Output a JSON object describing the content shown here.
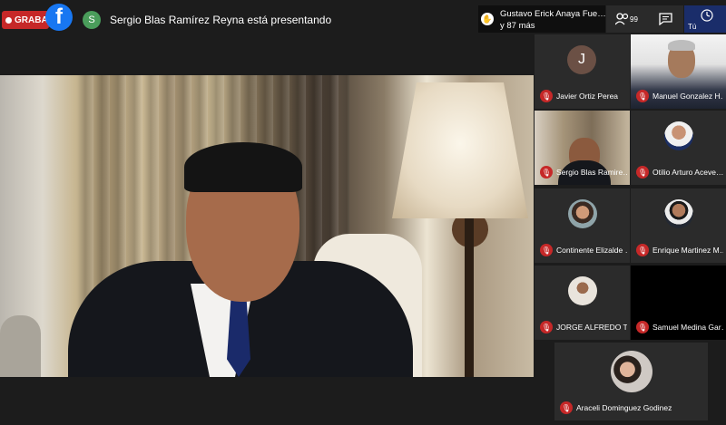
{
  "topbar": {
    "recording_label": "GRABA",
    "facebook_icon": "facebook-icon",
    "presenter_initial": "S",
    "presenter_text": "Sergio Blas Ramírez Reyna está presentando",
    "notification": {
      "line1": "Gustavo Erick Anaya Fue…",
      "line2": "y 87 más"
    },
    "controls": {
      "people_count": "99",
      "you_label": "Tú"
    }
  },
  "participants": [
    {
      "name": "Javier Ortiz Perea",
      "initial": "J",
      "type": "avatar"
    },
    {
      "name": "Manuel Gonzalez H…",
      "type": "video"
    },
    {
      "name": "Sergio Blas Ramire…",
      "type": "video"
    },
    {
      "name": "Otilio Arturo Aceve…",
      "type": "photo"
    },
    {
      "name": "Continente Elizalde …",
      "type": "photo"
    },
    {
      "name": "Enrique Martinez M…",
      "type": "photo"
    },
    {
      "name": "JORGE ALFREDO T…",
      "type": "photo"
    },
    {
      "name": "Samuel Medina Gar…",
      "type": "blank"
    },
    {
      "name": "Araceli Dominguez Godinez",
      "type": "photo"
    }
  ],
  "colors": {
    "background": "#1c1c1c",
    "tile": "#2b2b2b",
    "muted_red": "#c62828",
    "facebook_blue": "#1877f2",
    "you_blue": "#1a2d6a"
  }
}
